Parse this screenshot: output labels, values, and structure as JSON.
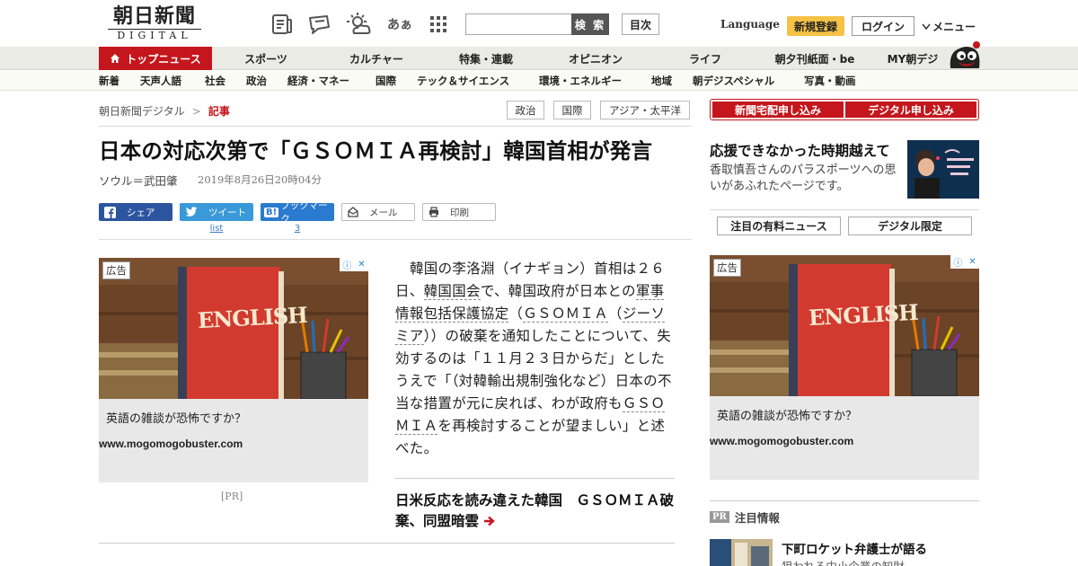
{
  "header": {
    "logo_line1": "朝日新聞",
    "logo_line2": "DIGITAL",
    "icons": [
      "newspaper-list-icon",
      "speech-ticket-icon",
      "weather-sun-cloud-icon",
      "font-size-icon",
      "grid-menu-icon"
    ],
    "font_size_glyph": "あぁ",
    "search": {
      "placeholder": "",
      "button_label": "検 索"
    },
    "toc_label": "目次",
    "language_label": "Language",
    "register_label": "新規登録",
    "login_label": "ログイン",
    "menu_label": "メニュー"
  },
  "main_nav": {
    "items": [
      {
        "label": "トップニュース",
        "active": true
      },
      {
        "label": "スポーツ"
      },
      {
        "label": "カルチャー"
      },
      {
        "label": "特集・連載"
      },
      {
        "label": "オピニオン"
      },
      {
        "label": "ライフ"
      },
      {
        "label": "朝夕刊紙面・be"
      },
      {
        "label": "MY朝デジ"
      }
    ]
  },
  "sub_nav": {
    "items": [
      "新着",
      "天声人語",
      "社会",
      "政治",
      "経済・マネー",
      "国際",
      "テック＆サイエンス",
      "環境・エネルギー",
      "地域",
      "朝デジスペシャル",
      "写真・動画"
    ]
  },
  "breadcrumb": {
    "home": "朝日新聞デジタル",
    "separator": ">",
    "current": "記事"
  },
  "tags": [
    "政治",
    "国際",
    "アジア・太平洋"
  ],
  "article": {
    "headline": "日本の対応次第で「ＧＳＯＭＩＡ再検討」韓国首相が発言",
    "byline": "ソウル＝武田肇",
    "date": "2019年8月26日20時04分",
    "body": {
      "p1": "韓国の李洛淵（イナギョン）首相は２６日、",
      "link1": "韓国国会",
      "p2": "で、韓国政府が日本との",
      "link2": "軍事情報包括保護協定",
      "p3": "（",
      "link3": "ＧＳＯＭＩＡ",
      "p4": "（",
      "link4": "ジーソミア",
      "p5": "））の破棄を通知したことについて、失効するのは「１１月２３日からだ」としたうえで「（対韓輸出規制強化など）日本の不当な措置が元に戻れば、わが政府も",
      "link5": "ＧＳＯＭＩＡ",
      "p6": "を再検討することが望ましい」と述べた。"
    },
    "related_link": "日米反応を読み違えた韓国　ＧＳＯＭＩＡ破棄、同盟暗雲"
  },
  "share": {
    "facebook": "シェア",
    "twitter": "ツイート",
    "hatena_mark": "B!",
    "hatena": "ブックマーク",
    "mail": "メール",
    "print": "印刷",
    "twitter_count": "list",
    "hatena_count": "3"
  },
  "ads": {
    "label": "広告",
    "book_title": "ENGLISH",
    "text": "英語の雑談が恐怖ですか？",
    "url": "www.mogomogobuster.com",
    "pr_label": "[PR]"
  },
  "sidebar": {
    "subscribe_paper": "新聞宅配申し込み",
    "subscribe_digital": "デジタル申し込み",
    "promo_title": "応援できなかった時期越えて",
    "promo_desc": "香取慎吾さんのパラスポーツへの思いがあふれたページです。",
    "tab_paid": "注目の有料ニュース",
    "tab_digital": "デジタル限定",
    "attention_badge": "PR",
    "attention_label": "注目情報",
    "attention_title": "下町ロケット弁護士が語る",
    "attention_sub": "狙われる中小企業の知財"
  },
  "colors": {
    "brand_red": "#c4161c",
    "register_yellow": "#f5c246",
    "facebook": "#2c55a0",
    "twitter": "#3a9ad9",
    "hatena": "#2a7bcf"
  }
}
